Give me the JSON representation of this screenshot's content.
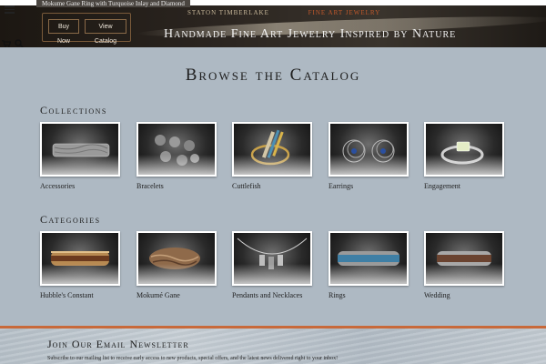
{
  "header": {
    "notice": "Mokume Gane Ring with Turquoise Inlay and Diamond",
    "brand_left": "STATON TIMBERLAKE",
    "brand_right": "FINE ART JEWELRY",
    "buttons": {
      "buy_now": "Buy Now",
      "view_catalog": "View Catalog"
    },
    "tagline": "Handmade Fine Art Jewelry Inspired by Nature",
    "icons": [
      "hamburger-icon",
      "cart-icon",
      "search-icon"
    ]
  },
  "main": {
    "title": "Browse the Catalog",
    "collections": {
      "heading": "Collections",
      "items": [
        {
          "label": "Accessories"
        },
        {
          "label": "Bracelets"
        },
        {
          "label": "Cuttlefish"
        },
        {
          "label": "Earrings"
        },
        {
          "label": "Engagement"
        }
      ]
    },
    "categories": {
      "heading": "Categories",
      "items": [
        {
          "label": "Hubble's Constant"
        },
        {
          "label": "Mokumé Gane"
        },
        {
          "label": "Pendants and Necklaces"
        },
        {
          "label": "Rings"
        },
        {
          "label": "Wedding"
        }
      ]
    }
  },
  "newsletter": {
    "title": "Join Our Email Newsletter",
    "text": "Subscribe to our mailing list to receive early access to new products, special offers, and the latest news delivered right to your inbox!"
  },
  "colors": {
    "background": "#aeb9c3",
    "accent": "#c8693a",
    "header_dark": "#2b2520"
  }
}
